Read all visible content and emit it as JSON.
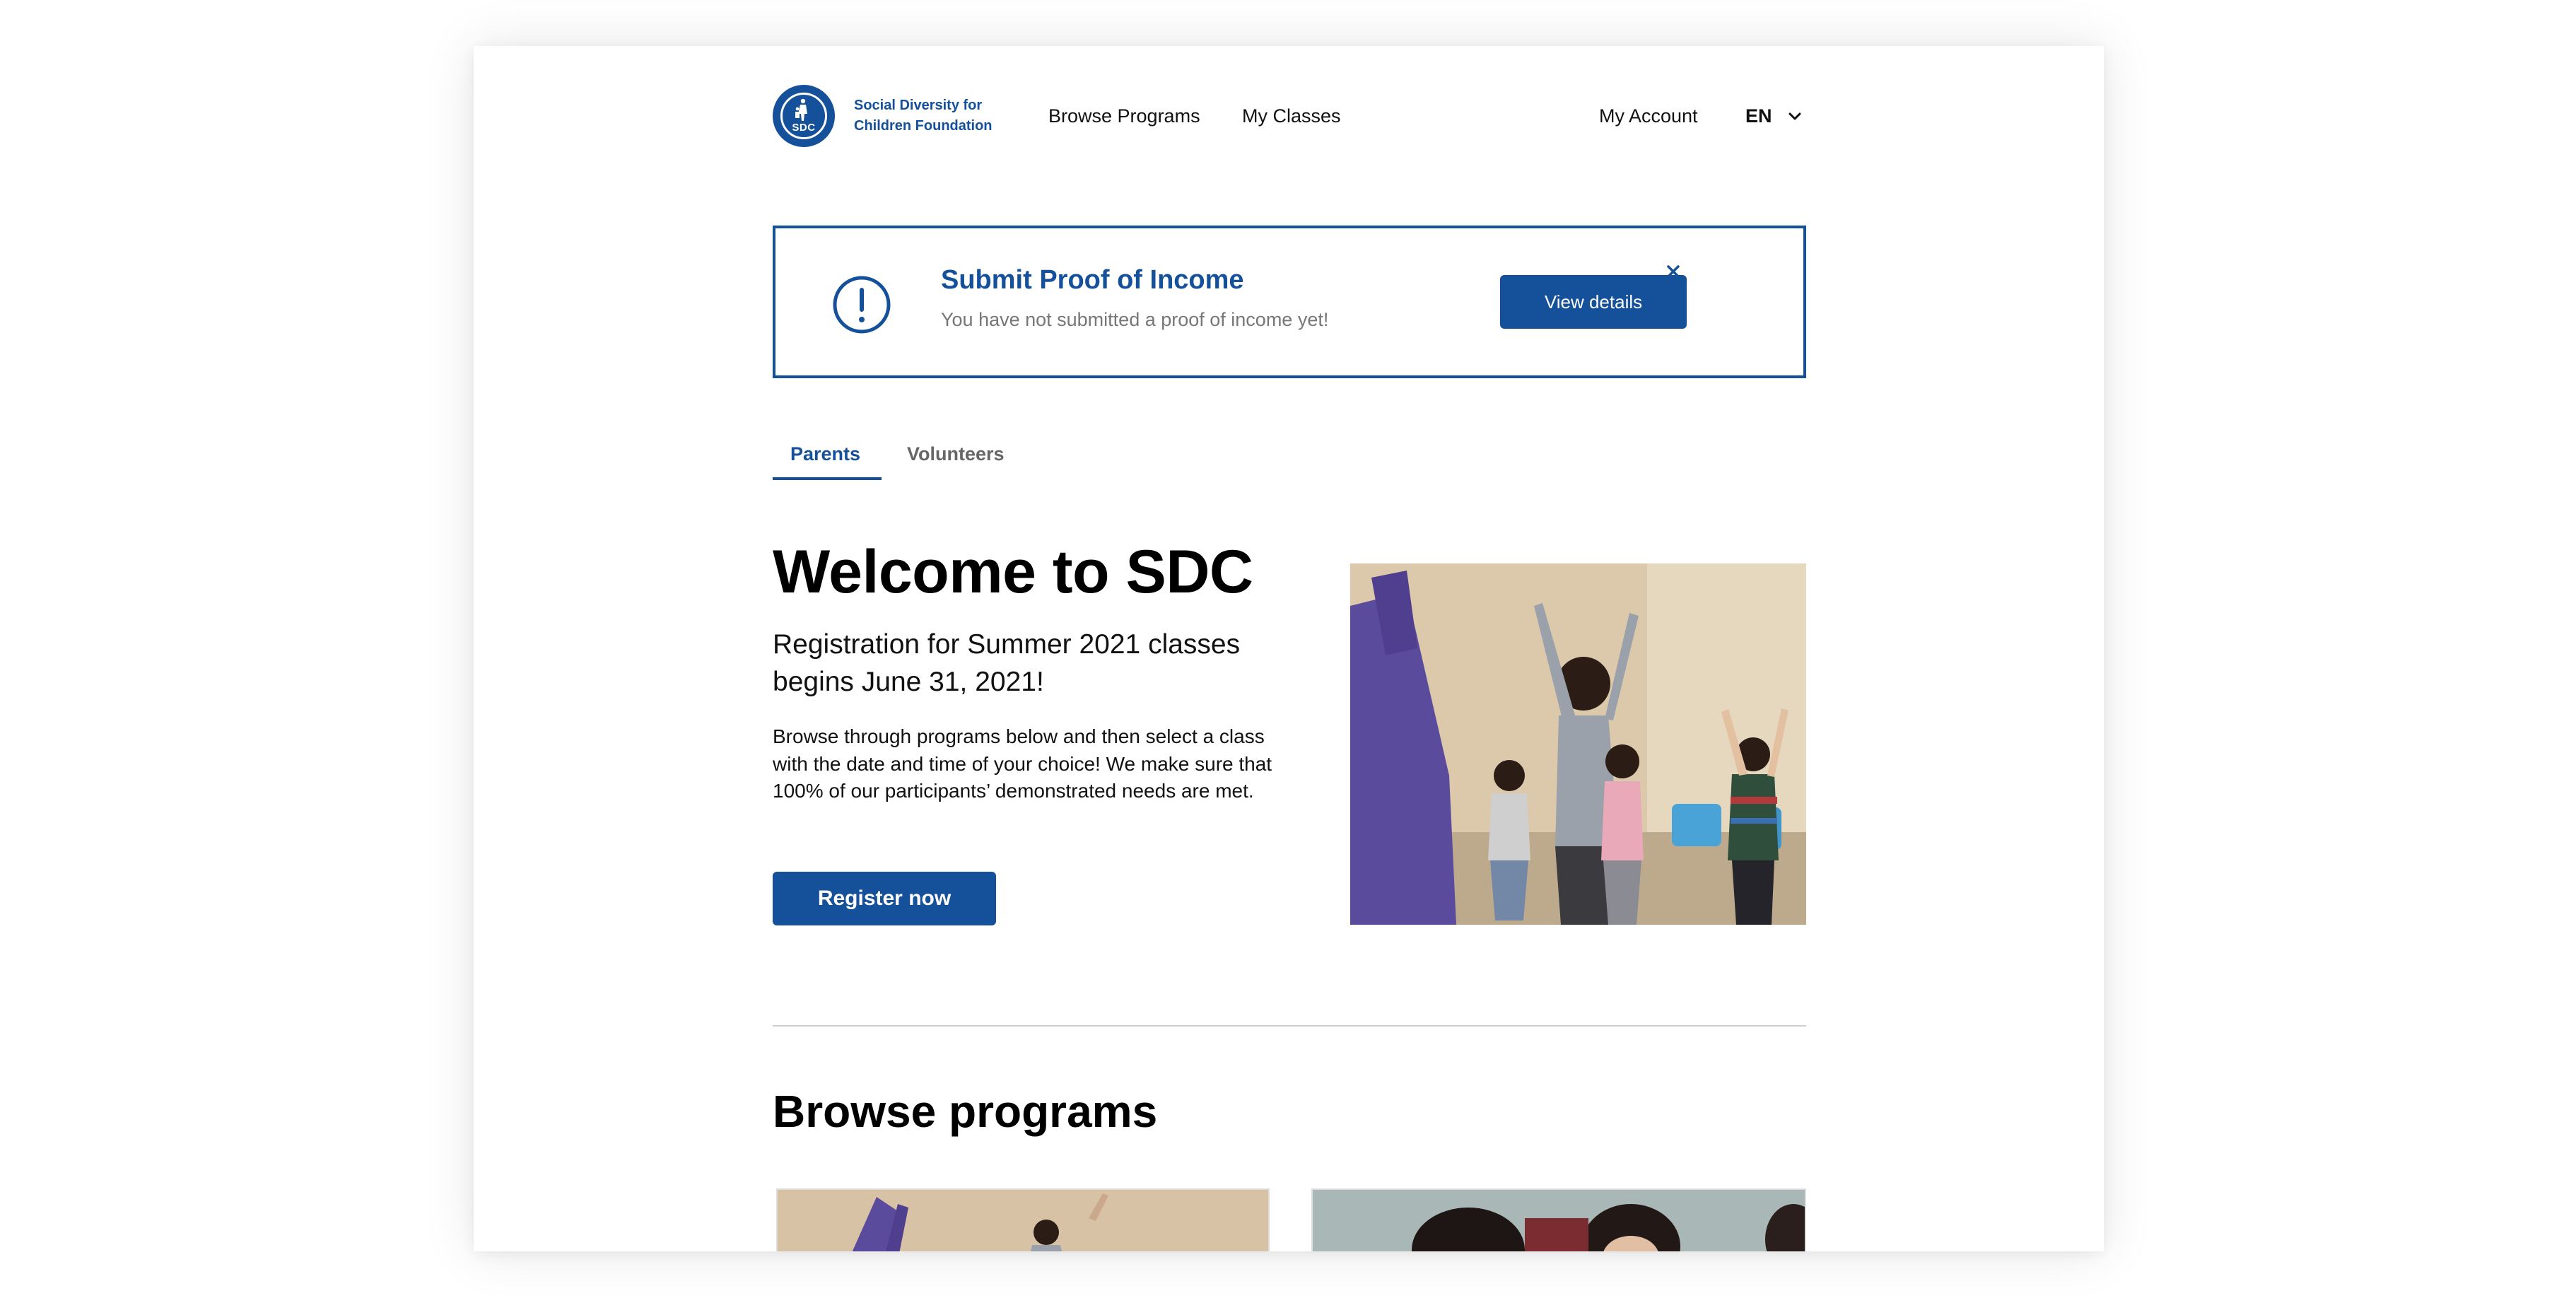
{
  "header": {
    "logo_badge": "SDC",
    "logo_line1": "Social Diversity for",
    "logo_line2": "Children Foundation",
    "nav": {
      "browse": "Browse Programs",
      "classes": "My Classes",
      "account": "My Account"
    },
    "language": "EN"
  },
  "alert": {
    "title": "Submit Proof of Income",
    "message": "You have not submitted a proof of income yet!",
    "button": "View details"
  },
  "tabs": [
    "Parents",
    "Volunteers"
  ],
  "hero": {
    "title": "Welcome to SDC",
    "subtitle": "Registration for Summer 2021 classes begins June 31, 2021!",
    "description": "Browse through programs below and then select a class with the date and time of your choice! We make sure that 100% of our participants’ demonstrated needs are met.",
    "button": "Register now"
  },
  "browse": {
    "title": "Browse programs"
  },
  "colors": {
    "brand": "#15509a"
  }
}
